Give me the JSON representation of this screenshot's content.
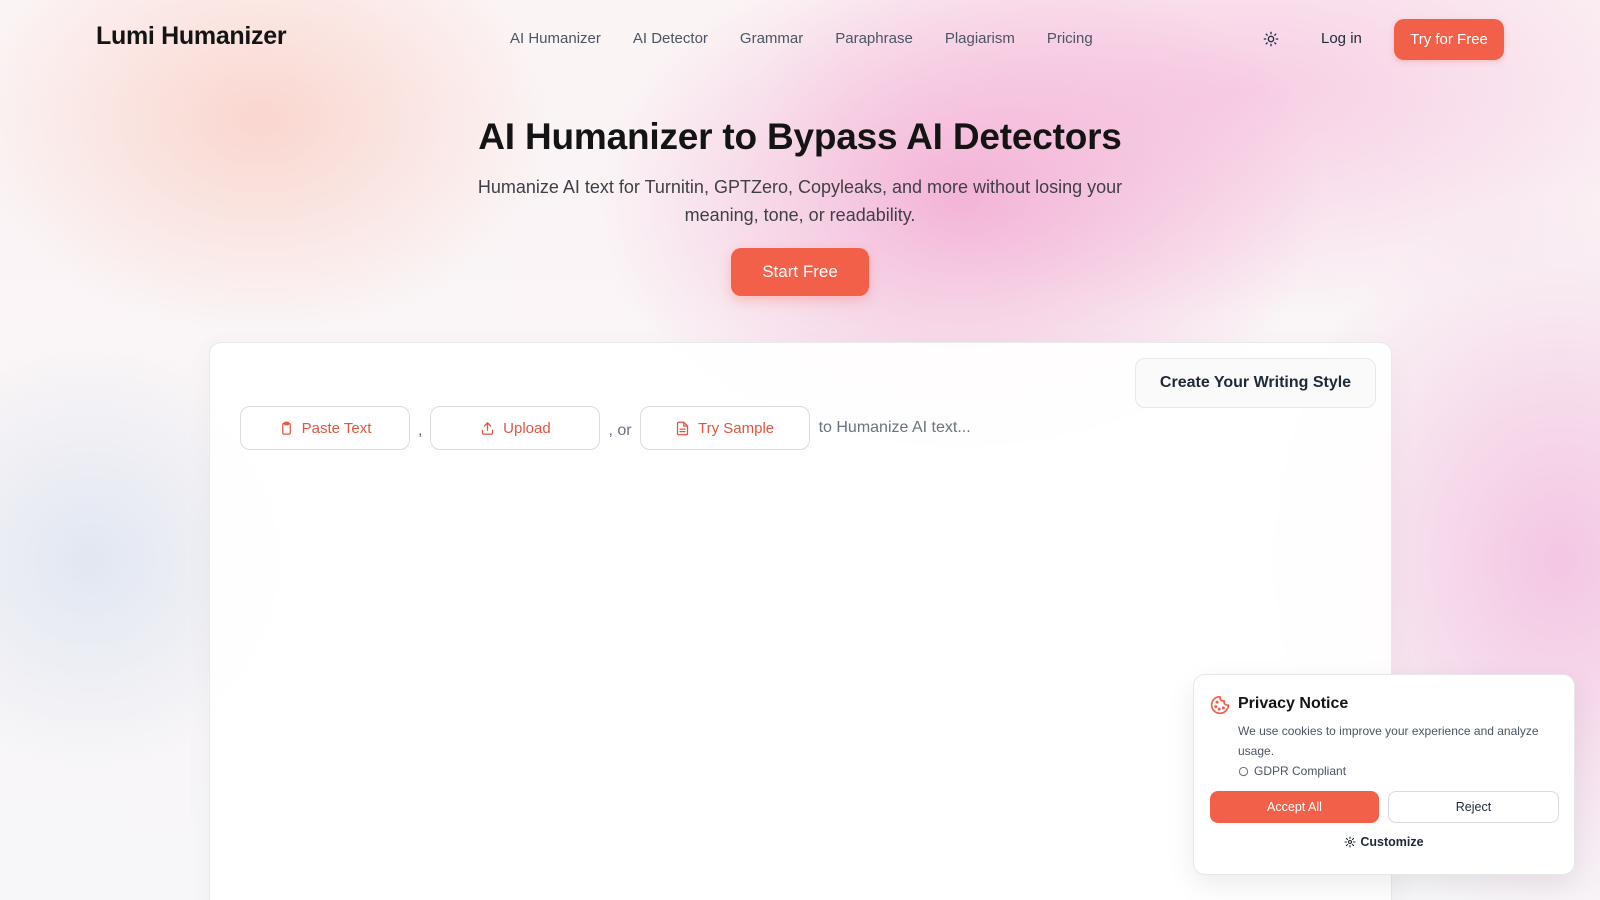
{
  "header": {
    "logo": "Lumi Humanizer",
    "nav": [
      "AI Humanizer",
      "AI Detector",
      "Grammar",
      "Paraphrase",
      "Plagiarism",
      "Pricing"
    ],
    "theme_icon": "sun-icon",
    "login_label": "Log in",
    "try_label": "Try for Free"
  },
  "hero": {
    "title": "AI Humanizer to Bypass AI Detectors",
    "subtitle": "Humanize AI text for Turnitin, GPTZero, Copyleaks, and more without losing your meaning, tone, or readability.",
    "cta_label": "Start Free"
  },
  "editor": {
    "style_button_label": "Create Your Writing Style",
    "paste_label": "Paste Text",
    "upload_label": "Upload",
    "sample_label": "Try Sample",
    "comma": ",",
    "or_text": ", or",
    "hint": "to Humanize AI text..."
  },
  "privacy": {
    "title": "Privacy Notice",
    "text": "We use cookies to improve your experience and analyze usage.",
    "gdpr": "GDPR Compliant",
    "accept_label": "Accept All",
    "reject_label": "Reject",
    "customize_label": "Customize"
  },
  "colors": {
    "accent": "#f2604a",
    "accent_text": "#e0563f"
  }
}
